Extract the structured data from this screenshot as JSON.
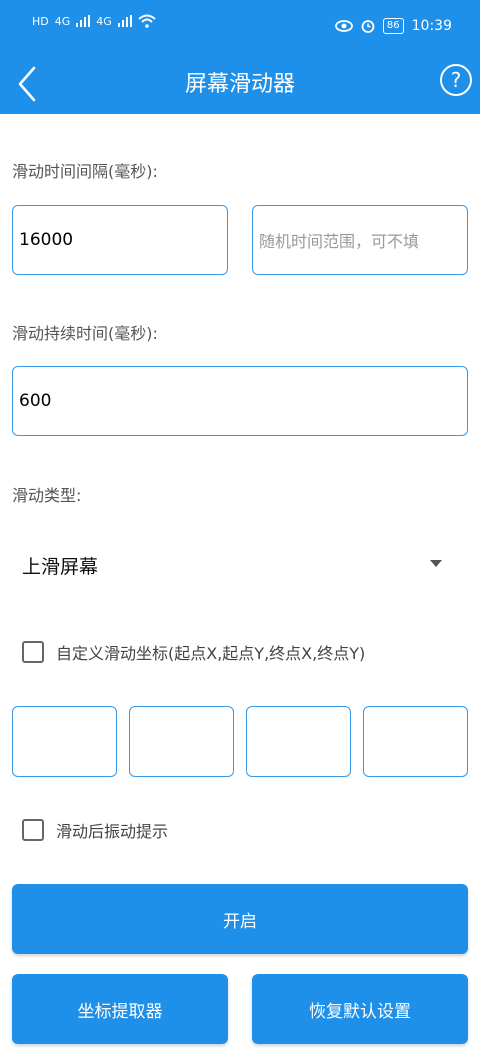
{
  "status_bar": {
    "left_badges": [
      "HD",
      "HD",
      "4G",
      "4G"
    ],
    "battery": "86",
    "time": "10:39"
  },
  "app_bar": {
    "title": "屏幕滑动器",
    "help_glyph": "?"
  },
  "interval": {
    "label": "滑动时间间隔(毫秒):",
    "value": "16000",
    "random_placeholder": "随机时间范围，可不填"
  },
  "duration": {
    "label": "滑动持续时间(毫秒):",
    "value": "600"
  },
  "swipe_type": {
    "label": "滑动类型:",
    "selected": "上滑屏幕"
  },
  "custom_coords": {
    "label": "自定义滑动坐标(起点X,起点Y,终点X,终点Y)",
    "checked": false
  },
  "vibrate": {
    "label": "滑动后振动提示",
    "checked": false
  },
  "buttons": {
    "start": "开启",
    "coord_picker": "坐标提取器",
    "reset": "恢复默认设置"
  },
  "colors": {
    "primary": "#1e90ea",
    "field_border": "#3a98e8"
  }
}
